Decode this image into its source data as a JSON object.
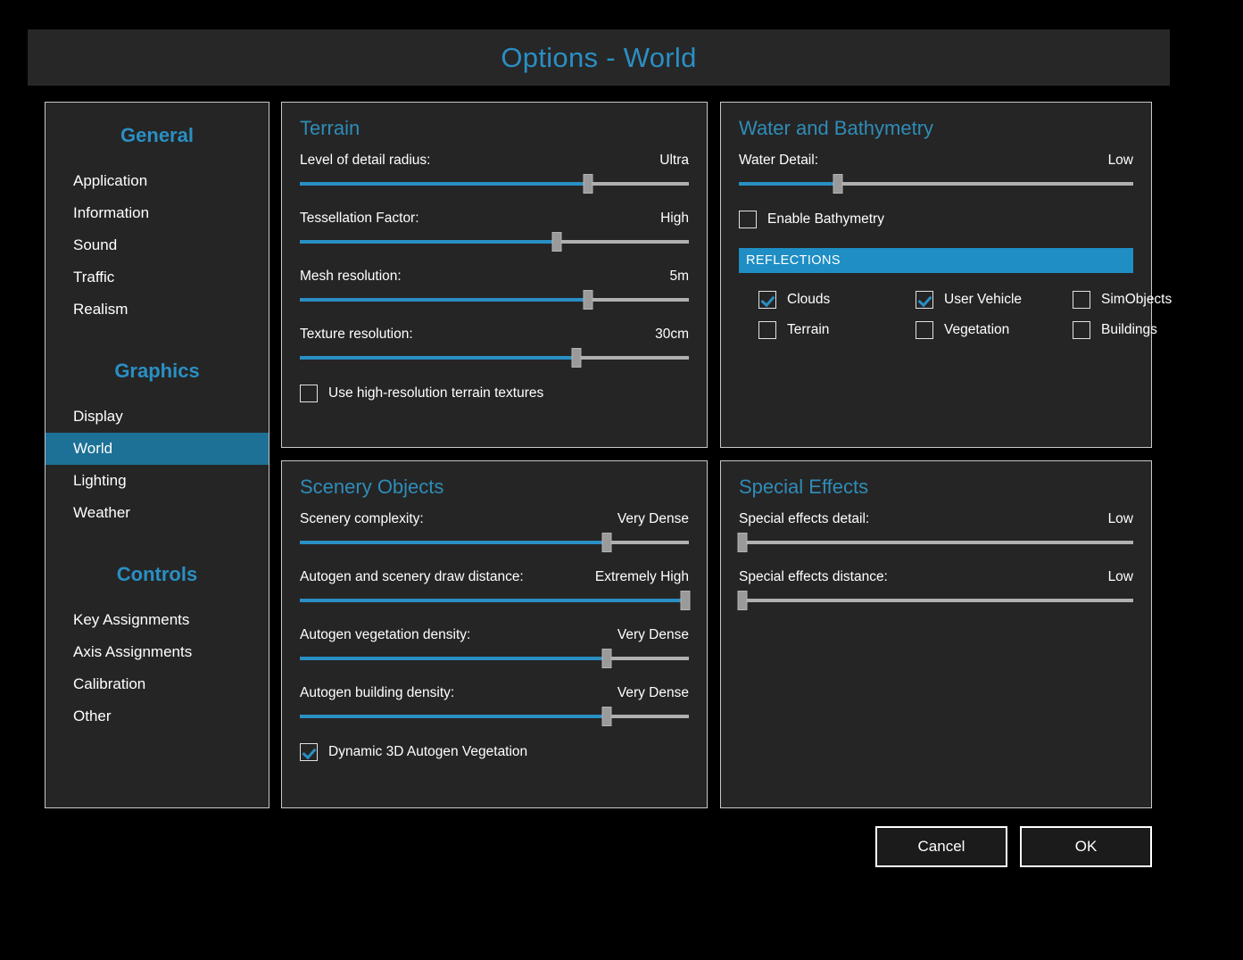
{
  "window": {
    "title": "Options - World"
  },
  "colors": {
    "accent": "#2a8fc4",
    "panel_bg": "#252525",
    "page_bg": "#000000",
    "active_nav": "#1d7196",
    "slider_fill": "#2a8fc4",
    "slider_track": "#b0b0b0",
    "reflections_header_bg": "#1f8ec4"
  },
  "sidebar": {
    "groups": [
      {
        "heading": "General",
        "items": [
          {
            "label": "Application",
            "active": false
          },
          {
            "label": "Information",
            "active": false
          },
          {
            "label": "Sound",
            "active": false
          },
          {
            "label": "Traffic",
            "active": false
          },
          {
            "label": "Realism",
            "active": false
          }
        ]
      },
      {
        "heading": "Graphics",
        "items": [
          {
            "label": "Display",
            "active": false
          },
          {
            "label": "World",
            "active": true
          },
          {
            "label": "Lighting",
            "active": false
          },
          {
            "label": "Weather",
            "active": false
          }
        ]
      },
      {
        "heading": "Controls",
        "items": [
          {
            "label": "Key Assignments",
            "active": false
          },
          {
            "label": "Axis Assignments",
            "active": false
          },
          {
            "label": "Calibration",
            "active": false
          },
          {
            "label": "Other",
            "active": false
          }
        ]
      }
    ]
  },
  "panels": {
    "terrain": {
      "title": "Terrain",
      "sliders": [
        {
          "label": "Level of detail radius:",
          "value": "Ultra",
          "percent": 74
        },
        {
          "label": "Tessellation Factor:",
          "value": "High",
          "percent": 66
        },
        {
          "label": "Mesh resolution:",
          "value": "5m",
          "percent": 74
        },
        {
          "label": "Texture resolution:",
          "value": "30cm",
          "percent": 71
        }
      ],
      "checkbox": {
        "label": "Use high-resolution terrain textures",
        "checked": false
      }
    },
    "water": {
      "title": "Water and Bathymetry",
      "sliders": [
        {
          "label": "Water Detail:",
          "value": "Low",
          "percent": 25
        }
      ],
      "checkbox": {
        "label": "Enable Bathymetry",
        "checked": false
      },
      "reflections": {
        "header": "REFLECTIONS",
        "options": [
          {
            "label": "Clouds",
            "checked": true
          },
          {
            "label": "User Vehicle",
            "checked": true
          },
          {
            "label": "SimObjects",
            "checked": false
          },
          {
            "label": "Terrain",
            "checked": false
          },
          {
            "label": "Vegetation",
            "checked": false
          },
          {
            "label": "Buildings",
            "checked": false
          }
        ]
      }
    },
    "scenery": {
      "title": "Scenery Objects",
      "sliders": [
        {
          "label": "Scenery complexity:",
          "value": "Very Dense",
          "percent": 79
        },
        {
          "label": "Autogen and scenery draw distance:",
          "value": "Extremely High",
          "percent": 99
        },
        {
          "label": "Autogen vegetation density:",
          "value": "Very Dense",
          "percent": 79
        },
        {
          "label": "Autogen building density:",
          "value": "Very Dense",
          "percent": 79
        }
      ],
      "checkbox": {
        "label": "Dynamic 3D Autogen Vegetation",
        "checked": true
      }
    },
    "effects": {
      "title": "Special Effects",
      "sliders": [
        {
          "label": "Special effects detail:",
          "value": "Low",
          "percent": 1
        },
        {
          "label": "Special effects distance:",
          "value": "Low",
          "percent": 1
        }
      ]
    }
  },
  "footer": {
    "cancel_label": "Cancel",
    "ok_label": "OK"
  }
}
